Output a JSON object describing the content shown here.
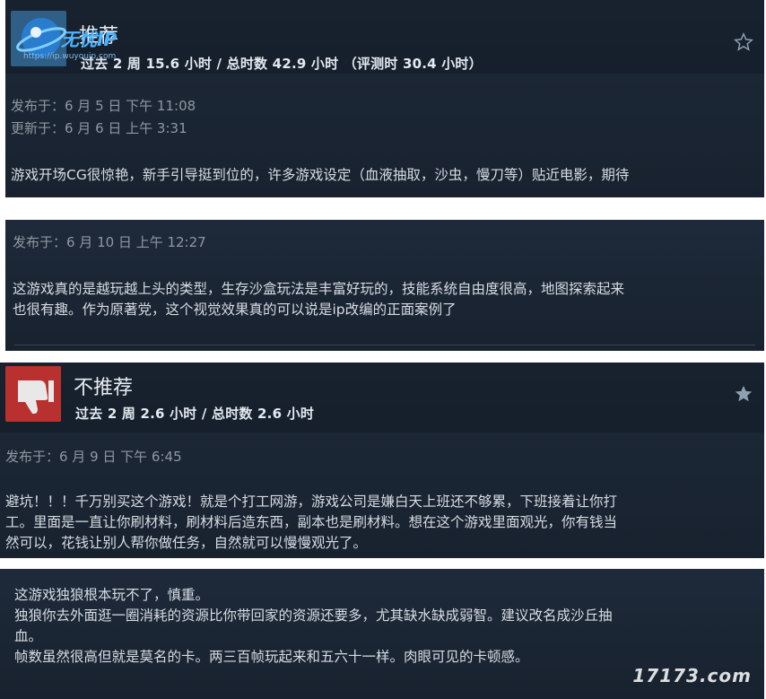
{
  "reviews": [
    {
      "verdict": "推荐",
      "hours": "过去 2 周 15.6 小时 / 总时数 42.9 小时 （评测时 30.4 小时）",
      "posted": "发布于：6 月 5 日 下午 11:08",
      "updated": "更新于：6 月 6 日 上午 3:31",
      "body": "游戏开场CG很惊艳，新手引导挺到位的，许多游戏设定（血液抽取，沙虫，慢刀等）贴近电影，期待"
    },
    {
      "posted": "发布于：6 月 10 日 上午 12:27",
      "body_lines": [
        "这游戏真的是越玩越上头的类型，生存沙盒玩法是丰富好玩的，技能系统自由度很高，地图探索起来",
        "也很有趣。作为原著党，这个视觉效果真的可以说是ip改编的正面案例了"
      ]
    },
    {
      "verdict": "不推荐",
      "hours": "过去 2 周 2.6 小时 / 总时数 2.6 小时",
      "posted": "发布于：6 月 9 日 下午 6:45",
      "body_lines": [
        "避坑！！！千万别买这个游戏！就是个打工网游，游戏公司是嫌白天上班还不够累，下班接着让你打",
        "工。里面是一直让你刷材料，刷材料后造东西，副本也是刷材料。想在这个游戏里面观光，你有钱当",
        "然可以，花钱让别人帮你做任务，自然就可以慢慢观光了。"
      ]
    },
    {
      "body_lines": [
        "这游戏独狼根本玩不了，慎重。",
        "独狼你去外面逛一圈消耗的资源比你带回家的资源还要多，尤其缺水缺成弱智。建议改名成沙丘抽",
        "血。",
        "帧数虽然很高但就是莫名的卡。两三百帧玩起来和五六十一样。肉眼可见的卡顿感。"
      ]
    }
  ],
  "watermark": {
    "name": "无忧IP",
    "url": "https://ip.wuyouip.com"
  },
  "site_mark": "17173.com",
  "icons": {
    "thumbs_up": "thumbs-up-icon",
    "thumbs_down": "thumbs-down-icon",
    "star": "star-icon"
  },
  "colors": {
    "card_bg": "#1b2838",
    "thumbs_down": "#c43a37",
    "thumbs_up": "#2f5f86"
  }
}
